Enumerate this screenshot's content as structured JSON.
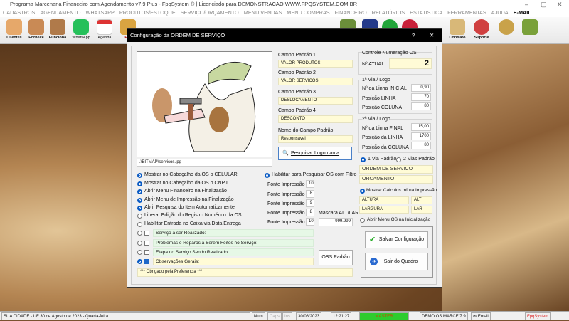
{
  "window": {
    "title": "Programa Marcenaria Financeiro com Agendamento v7.9 Plus - FpqSystem ® | Licenciado para  DEMONSTRACAO WWW.FPQSYSTEM.COM.BR",
    "min": "–",
    "max": "▢",
    "close": "✕"
  },
  "menu": [
    "CADASTROS",
    "AGENDAMENTO",
    "WHATSAPP",
    "PRODUTOS/ESTOQUE",
    "SERVIÇO/ORÇAMENTO",
    "MENU VENDAS",
    "MENU COMPRAS",
    "FINANCEIRO",
    "RELATÓRIOS",
    "ESTATISTICA",
    "FERRAMENTAS",
    "AJUDA",
    "E-MAIL"
  ],
  "toolbar": {
    "clientes": "Clientes",
    "fornece": "Fornece",
    "funciona": "Funciona",
    "whatsapp": "WhatsApp",
    "agenda": "Agenda",
    "pro": "Pro",
    "contrato": "Contrato",
    "suporte": "Suporte"
  },
  "dialog": {
    "title": "Configuração da ORDEM DE SERVIÇO",
    "help": "?",
    "close": "✕",
    "image_path": ".\\BITMAP\\servicos.jpg",
    "campos": [
      {
        "label": "Campo Padrão 1",
        "value": "VALOR PRODUTOS"
      },
      {
        "label": "Campo Padrão 2",
        "value": "VALOR SERVICOS"
      },
      {
        "label": "Campo Padrão 3",
        "value": "DESLOCAMENTO"
      },
      {
        "label": "Campo Padrão 4",
        "value": "DESCONTO"
      },
      {
        "label": "Nome do Campo Padrão",
        "value": "Responsavel"
      }
    ],
    "pesquisar_logo": "Pesquisar Logomarca",
    "controle": {
      "title": "Controle Numeração OS",
      "label": "Nº ATUAL",
      "value": "2"
    },
    "via1": {
      "title": "1ª Via / Logo",
      "rows": [
        {
          "label": "Nº da Linha INICIAL",
          "value": "0,90"
        },
        {
          "label": "Posição LINHA",
          "value": "70"
        },
        {
          "label": "Posição COLUNA",
          "value": "80"
        }
      ]
    },
    "via2": {
      "title": "2ª Via / Logo",
      "rows": [
        {
          "label": "Nº da Linha FINAL",
          "value": "15,00"
        },
        {
          "label": "Posição da LINHA",
          "value": "1700"
        },
        {
          "label": "Posição da COLUNA",
          "value": "80"
        }
      ]
    },
    "via_radio": {
      "one": "1 Via Padrão",
      "two": "2 Vias Padrão"
    },
    "titles": {
      "os": "ORDEM DE SERVICO",
      "orc": "ORCAMENTO"
    },
    "calc": {
      "label": "Mostrar Calculos m² na Impressão",
      "altura": "ALTURA",
      "alt": "ALT",
      "largura": "LARGURA",
      "lar": "LAR"
    },
    "abrir_menu_os": "Abrir Menu OS na Inicialização",
    "options": [
      {
        "label": "Mostrar no Cabeçalho da OS o CELULAR",
        "on": true
      },
      {
        "label": "Mostrar no Cabeçalho da OS o CNPJ",
        "on": true
      },
      {
        "label": "Abrir Menu Financeiro na Finalização",
        "on": true
      },
      {
        "label": "Abrir Menu de Impressão na Finalização",
        "on": true
      },
      {
        "label": "Abrir Pesquisa do Item Automaticamente",
        "on": true
      },
      {
        "label": "Liberar Edição do Registro Numérico da OS",
        "on": false
      },
      {
        "label": "Habilitar Entrada no Caixa via Data Entrega",
        "on": false
      }
    ],
    "filtro": "Habilitar para Pesquisar OS com Filtro",
    "fontes": [
      {
        "label": "Fonte Impressão 1",
        "value": "10"
      },
      {
        "label": "Fonte Impressão 2",
        "value": "8"
      },
      {
        "label": "Fonte Impressão 3",
        "value": "9"
      },
      {
        "label": "Fonte Impressão 4",
        "value": "8"
      },
      {
        "label": "Fonte Impressão 5",
        "value": "10"
      }
    ],
    "mascara": {
      "label": "Mascara ALT/LAR",
      "value": "999.999"
    },
    "obs_fields": [
      {
        "label": "Serviço a ser Realizado:",
        "on": false
      },
      {
        "label": "Problemas e Reparos a Serem Feitos no Serviço:",
        "on": false
      },
      {
        "label": "Etapa do Serviço Sendo Realizado:",
        "on": false
      },
      {
        "label": "Observações Gerais:",
        "on": true
      }
    ],
    "obs_padrao": "OBS Padrão",
    "obrigado": "*** Obrigado pela Preferencia ***",
    "salvar": "Salvar Configuração",
    "sair": "Sair do Quadro"
  },
  "status": {
    "city": "SUA CIDADE - UF 30 de Agosto de 2023 - Quarta-feira",
    "num": "Num",
    "caps": "Caps",
    "ins": "Ins",
    "date": "30/08/2023",
    "time": "12:21:27",
    "user": "MASTER",
    "demo": "DEMO OS MARCE 7.9",
    "email": "Email",
    "brand": "FpqSystem"
  }
}
